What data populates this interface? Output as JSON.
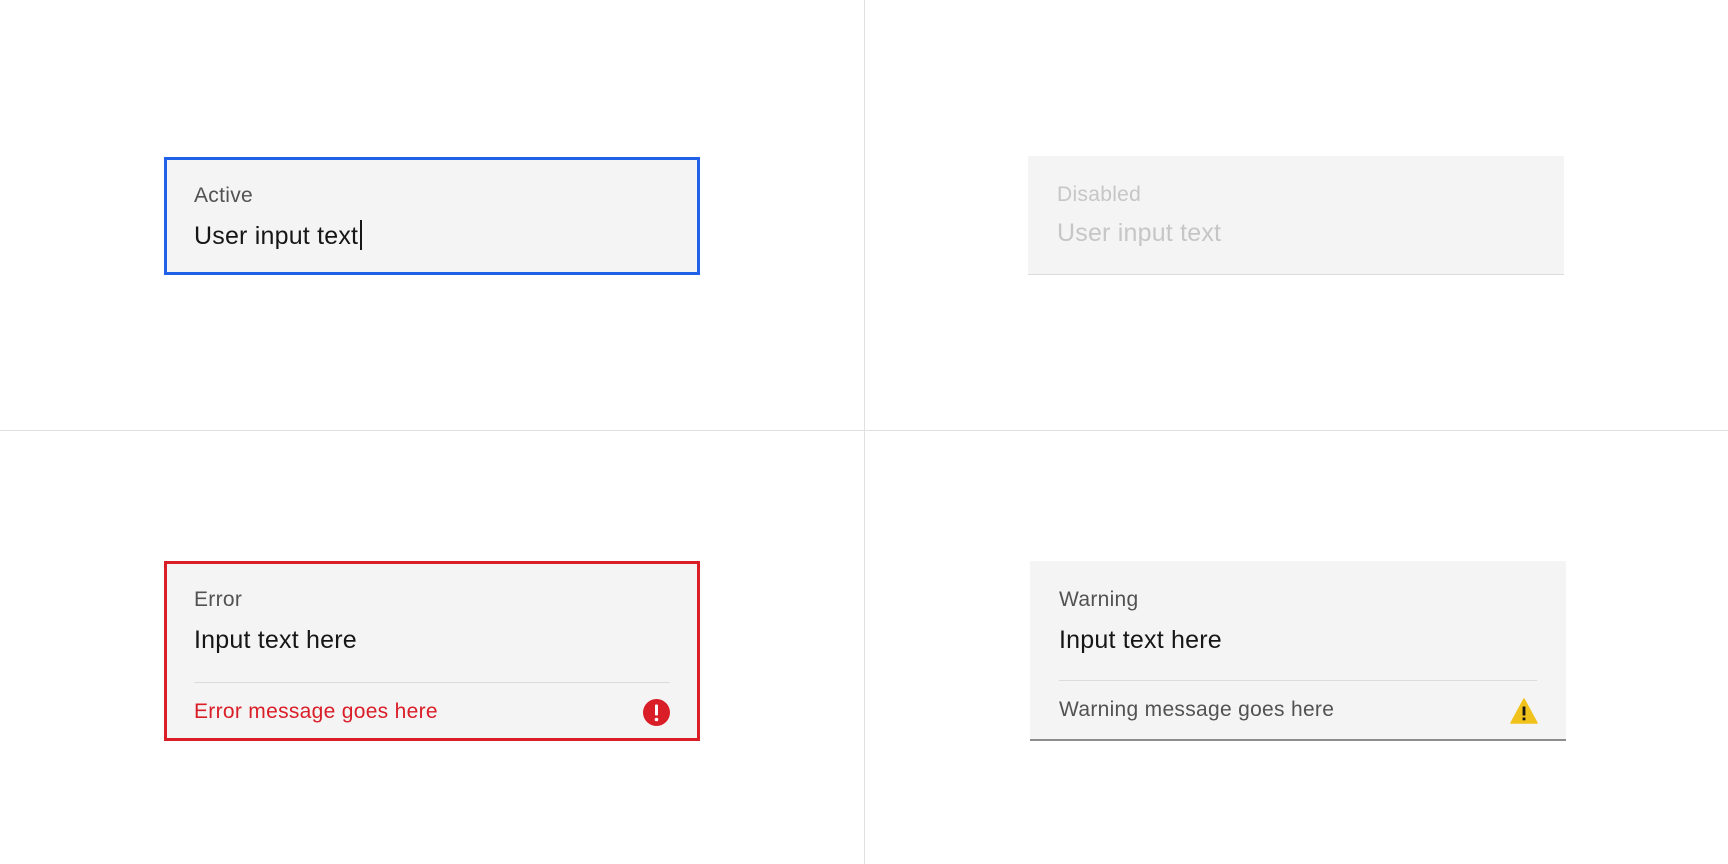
{
  "colors": {
    "active_border": "#1f62e8",
    "error": "#da1e28",
    "warning_icon": "#f1c21b",
    "field_background": "#f4f4f4",
    "disabled_text": "#c6c6c6"
  },
  "fields": {
    "active": {
      "label": "Active",
      "value": "User input text"
    },
    "disabled": {
      "label": "Disabled",
      "value": "User input text"
    },
    "error": {
      "label": "Error",
      "value": "Input text here",
      "message": "Error message goes here",
      "icon": "error-filled-icon"
    },
    "warning": {
      "label": "Warning",
      "value": "Input text here",
      "message": "Warning message goes here",
      "icon": "warning-triangle-icon"
    }
  }
}
